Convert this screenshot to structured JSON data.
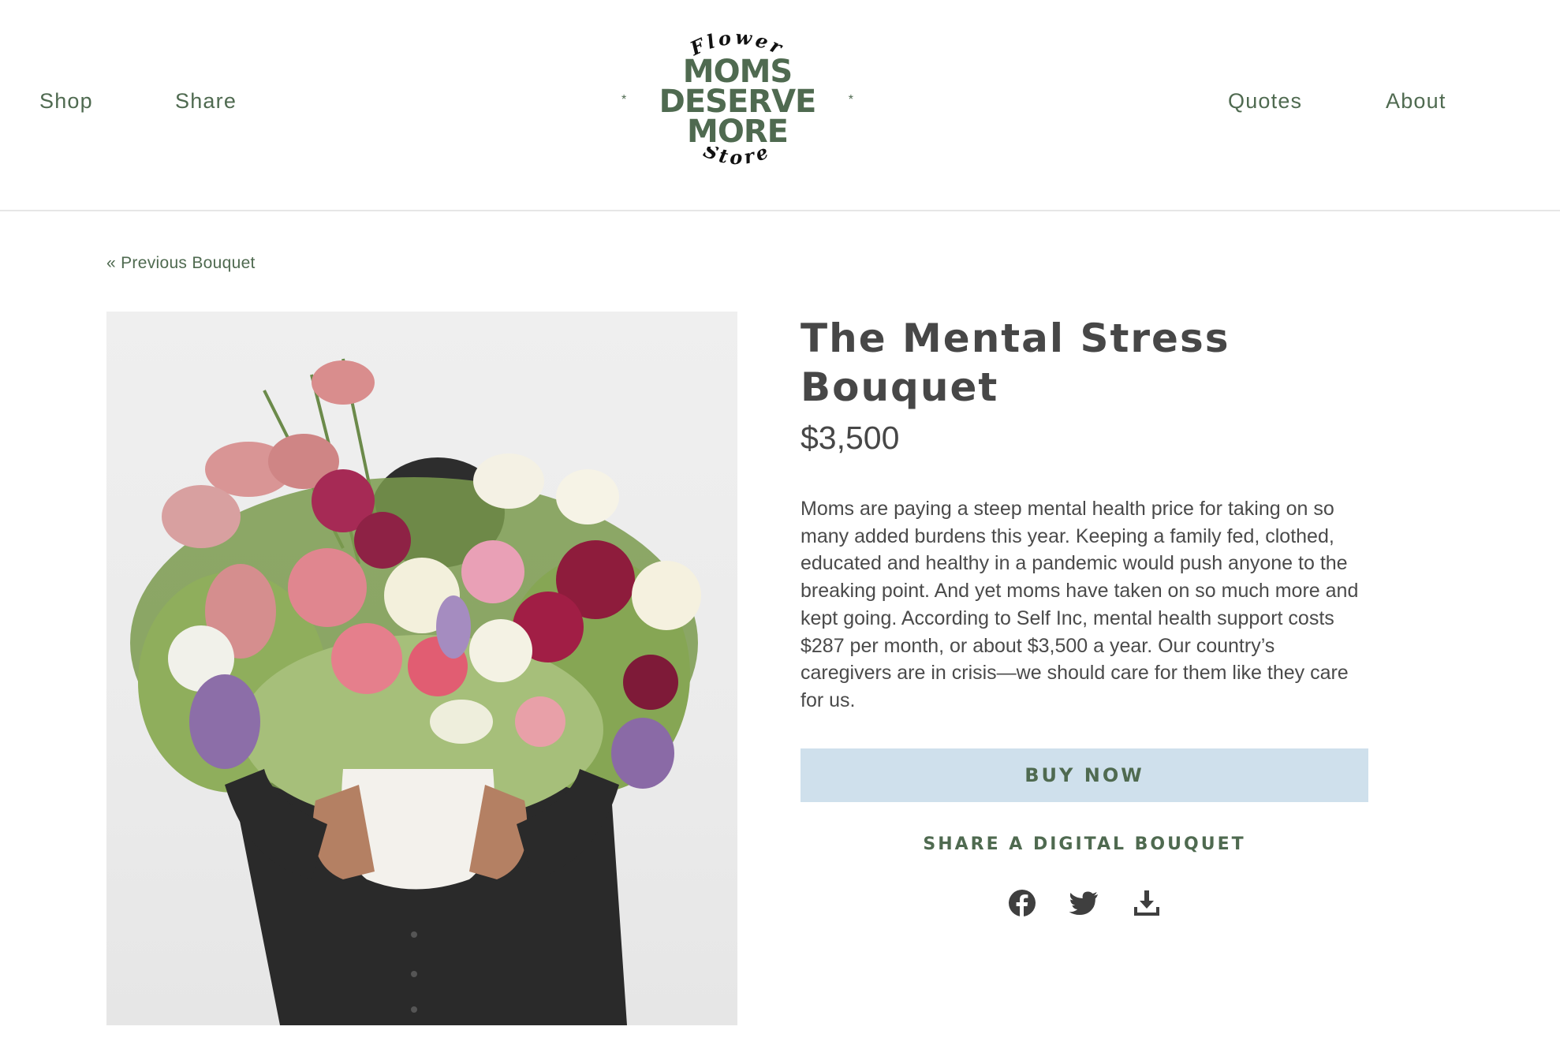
{
  "nav": {
    "left": [
      {
        "label": "Shop"
      },
      {
        "label": "Share"
      }
    ],
    "right": [
      {
        "label": "Quotes"
      },
      {
        "label": "About"
      }
    ]
  },
  "logo": {
    "arc_top": "Flower",
    "main": "MOMS\nDESERVE\nMORE",
    "arc_bottom": "Store",
    "star": "*"
  },
  "breadcrumb": {
    "previous": "« Previous Bouquet"
  },
  "product": {
    "title": "The Mental Stress Bouquet",
    "price": "$3,500",
    "description": "Moms are paying a steep mental health price for taking on so many added burdens this year. Keeping a family fed, clothed, educated and healthy in a pandemic would push anyone to the breaking point. And yet moms have taken on so much more and kept going. According to Self Inc, mental health support costs $287 per month, or about $3,500 a year. Our country’s caregivers are in crisis—we should care for them like they care for us.",
    "buy_label": "BUY NOW"
  },
  "share": {
    "heading": "SHARE A DIGITAL BOUQUET",
    "icons": [
      "facebook-icon",
      "twitter-icon",
      "download-icon"
    ]
  },
  "colors": {
    "brand_green": "#4f6a50",
    "button_bg": "#cfe0ec",
    "text": "#474747"
  }
}
